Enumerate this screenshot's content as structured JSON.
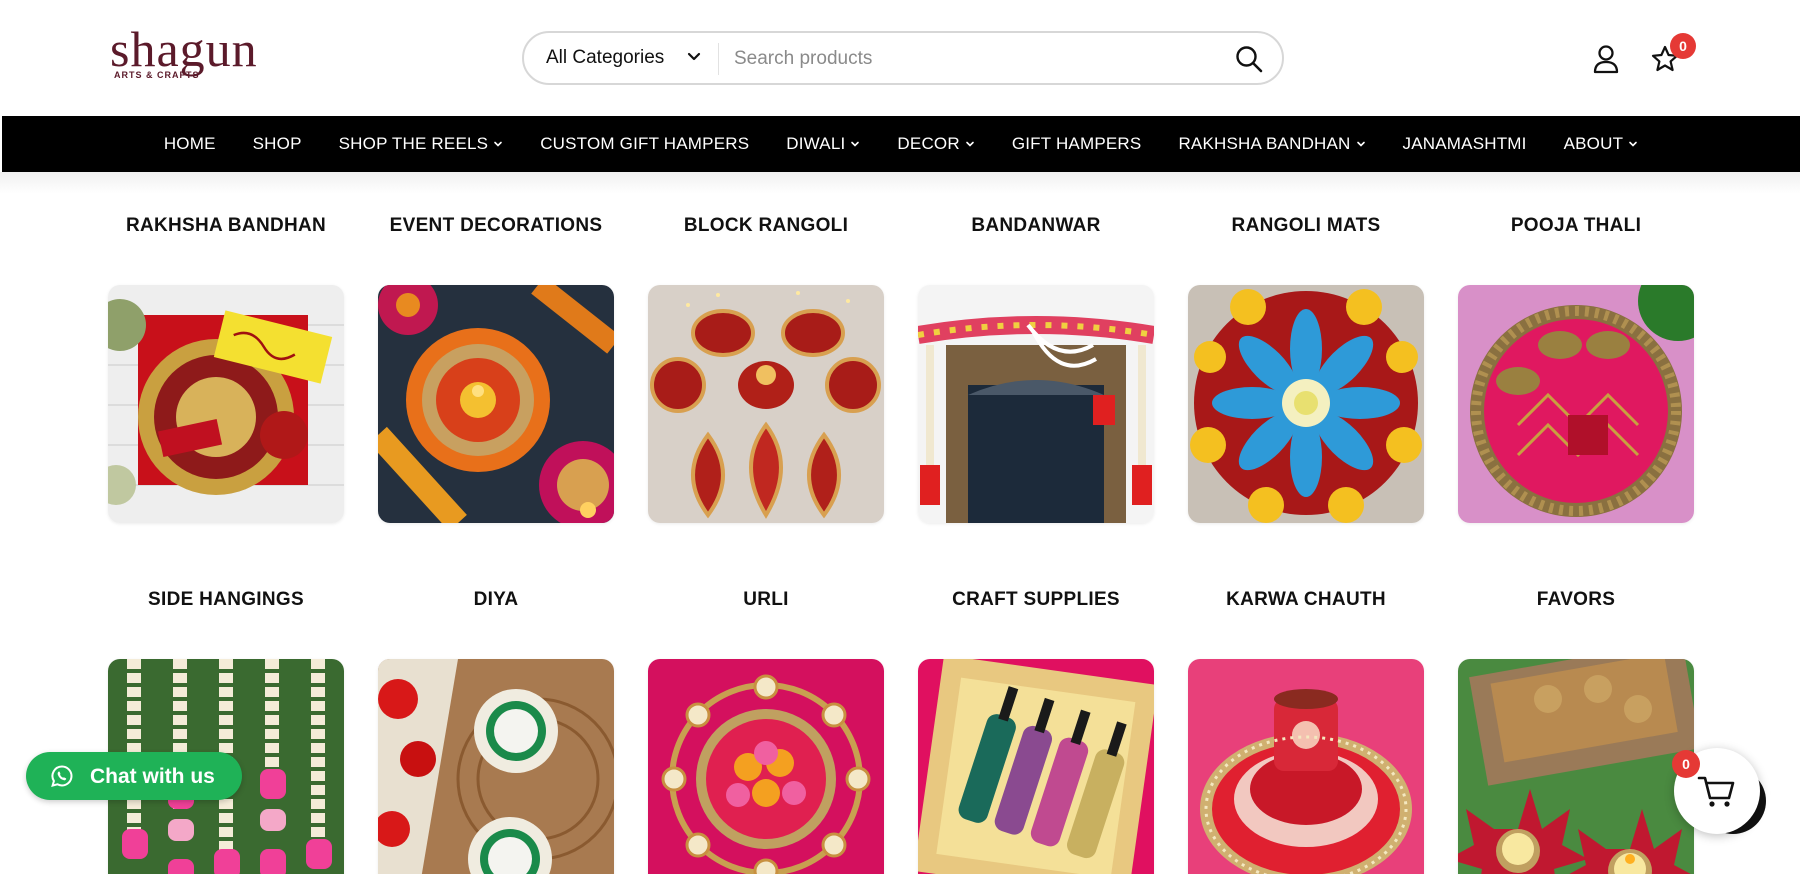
{
  "brand": {
    "name": "shagun",
    "tagline": "ARTS & CRAFTS",
    "color": "#5b1a2a"
  },
  "search": {
    "category_label": "All Categories",
    "placeholder": "Search products",
    "value": ""
  },
  "header_icons": {
    "account": "user-icon",
    "wishlist": "star-icon",
    "wishlist_count": "0"
  },
  "nav": {
    "items": [
      {
        "label": "HOME",
        "dropdown": false
      },
      {
        "label": "SHOP",
        "dropdown": false
      },
      {
        "label": "SHOP THE REELS",
        "dropdown": true
      },
      {
        "label": "CUSTOM GIFT HAMPERS",
        "dropdown": false
      },
      {
        "label": "DIWALI",
        "dropdown": true
      },
      {
        "label": "DECOR",
        "dropdown": true
      },
      {
        "label": "GIFT HAMPERS",
        "dropdown": false
      },
      {
        "label": "RAKHSHA BANDHAN",
        "dropdown": true
      },
      {
        "label": "JANAMASHTMI",
        "dropdown": false
      },
      {
        "label": "ABOUT",
        "dropdown": true
      }
    ]
  },
  "categories": [
    {
      "title": "RAKHSHA BANDHAN",
      "image": "rakhi-thali-photo"
    },
    {
      "title": "EVENT DECORATIONS",
      "image": "floral-diya-decor-photo"
    },
    {
      "title": "BLOCK RANGOLI",
      "image": "block-rangoli-photo"
    },
    {
      "title": "BANDANWAR",
      "image": "door-bandanwar-photo"
    },
    {
      "title": "RANGOLI MATS",
      "image": "rangoli-mat-photo"
    },
    {
      "title": "POOJA THALI",
      "image": "pooja-thali-photo"
    },
    {
      "title": "SIDE HANGINGS",
      "image": "side-hangings-photo"
    },
    {
      "title": "DIYA",
      "image": "shell-diya-photo"
    },
    {
      "title": "URLI",
      "image": "urli-photo"
    },
    {
      "title": "CRAFT SUPPLIES",
      "image": "glitter-bottles-photo"
    },
    {
      "title": "KARWA CHAUTH",
      "image": "karwa-chauth-set-photo"
    },
    {
      "title": "FAVORS",
      "image": "lotus-tealight-photo"
    }
  ],
  "chat": {
    "label": "Chat with us",
    "icon": "whatsapp-icon",
    "color": "#1fb257"
  },
  "cart": {
    "count": "0",
    "icon": "cart-icon",
    "badge_color": "#e53935"
  }
}
